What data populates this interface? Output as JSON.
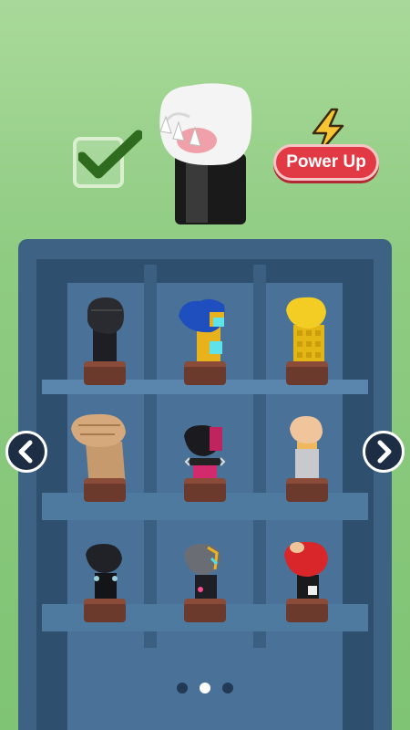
{
  "header": {
    "powerup_label": "Power Up"
  },
  "colors": {
    "background": "#8fcc82",
    "cabinet": "#3e6284",
    "powerup": "#e13a45",
    "check": "#2f6b1e"
  },
  "icons": {
    "check": "check-mark-icon",
    "bolt": "lightning-bolt-icon",
    "prev": "chevron-left-icon",
    "next": "chevron-right-icon"
  },
  "gloves": [
    {
      "name": "black-fist"
    },
    {
      "name": "blue-robot-fist"
    },
    {
      "name": "gold-fist"
    },
    {
      "name": "stone-fist"
    },
    {
      "name": "spiked-pink-fist"
    },
    {
      "name": "bare-wristband-fist"
    },
    {
      "name": "dark-cuff-fist"
    },
    {
      "name": "cyber-fist"
    },
    {
      "name": "red-glove-fist"
    }
  ],
  "pagination": {
    "pages": 3,
    "current": 2
  }
}
